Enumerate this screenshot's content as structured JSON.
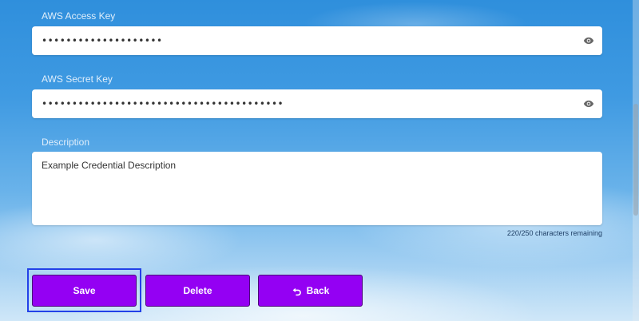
{
  "form": {
    "access_key": {
      "label": "AWS Access Key",
      "masked_value": "••••••••••••••••••••",
      "toggle_icon": "eye-icon"
    },
    "secret_key": {
      "label": "AWS Secret Key",
      "masked_value": "••••••••••••••••••••••••••••••••••••••••",
      "toggle_icon": "eye-icon"
    },
    "description": {
      "label": "Description",
      "value": "Example Credential Description",
      "counter": "220/250 characters remaining"
    }
  },
  "actions": {
    "save_label": "Save",
    "delete_label": "Delete",
    "back_label": "Back",
    "back_icon": "undo-arrow-icon"
  },
  "colors": {
    "button_bg": "#9400f3",
    "focus_outline": "#2341e8",
    "sky_top": "#2f8fdc"
  }
}
